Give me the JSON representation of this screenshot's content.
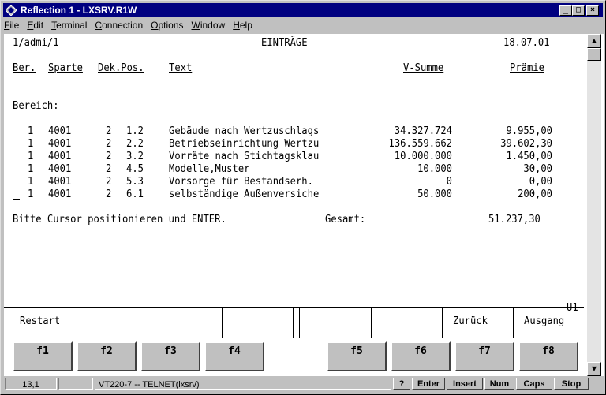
{
  "window": {
    "title": "Reflection 1 - LXSRV.R1W"
  },
  "menu": [
    "File",
    "Edit",
    "Terminal",
    "Connection",
    "Options",
    "Window",
    "Help"
  ],
  "terminal": {
    "header": {
      "left": "1/admi/1",
      "center": "EINTRÄGE",
      "date": "18.07.01"
    },
    "columns": {
      "ber": "Ber.",
      "sparte": "Sparte",
      "dekpos": "Dek.Pos.",
      "text": "Text",
      "vsumme": "V-Summe",
      "praemie": "Prämie"
    },
    "section_label": "Bereich:",
    "rows": [
      {
        "ber": "1",
        "sparte": "4001",
        "dek": "2",
        "pos": "1.2",
        "text": "Gebäude nach Wertzuschlags",
        "vsumme": "34.327.724",
        "praemie": "9.955,00"
      },
      {
        "ber": "1",
        "sparte": "4001",
        "dek": "2",
        "pos": "2.2",
        "text": "Betriebseinrichtung Wertzu",
        "vsumme": "136.559.662",
        "praemie": "39.602,30"
      },
      {
        "ber": "1",
        "sparte": "4001",
        "dek": "2",
        "pos": "3.2",
        "text": "Vorräte nach Stichtagsklau",
        "vsumme": "10.000.000",
        "praemie": "1.450,00"
      },
      {
        "ber": "1",
        "sparte": "4001",
        "dek": "2",
        "pos": "4.5",
        "text": "Modelle,Muster",
        "vsumme": "10.000",
        "praemie": "30,00"
      },
      {
        "ber": "1",
        "sparte": "4001",
        "dek": "2",
        "pos": "5.3",
        "text": "Vorsorge für Bestandserh.",
        "vsumme": "0",
        "praemie": "0,00"
      },
      {
        "ber": "1",
        "sparte": "4001",
        "dek": "2",
        "pos": "6.1",
        "text": "selbständige Außenversiche",
        "vsumme": "50.000",
        "praemie": "200,00"
      }
    ],
    "cursor_row": 5,
    "prompt": "Bitte Cursor positionieren und ENTER.",
    "total_label": "Gesamt:",
    "total_value": "51.237,30",
    "screen_id": "U1",
    "softkey_labels": [
      "Restart",
      "",
      "",
      "",
      "",
      "",
      "Zurück",
      "Ausgang"
    ],
    "fkeys": [
      "f1",
      "f2",
      "f3",
      "f4",
      "f5",
      "f6",
      "f7",
      "f8"
    ]
  },
  "status": {
    "cursor_pos": "13,1",
    "blank": "",
    "session": "VT220-7 -- TELNET(lxsrv)",
    "help": "?",
    "enter": "Enter",
    "insert": "Insert",
    "num": "Num",
    "caps": "Caps",
    "stop": "Stop"
  }
}
